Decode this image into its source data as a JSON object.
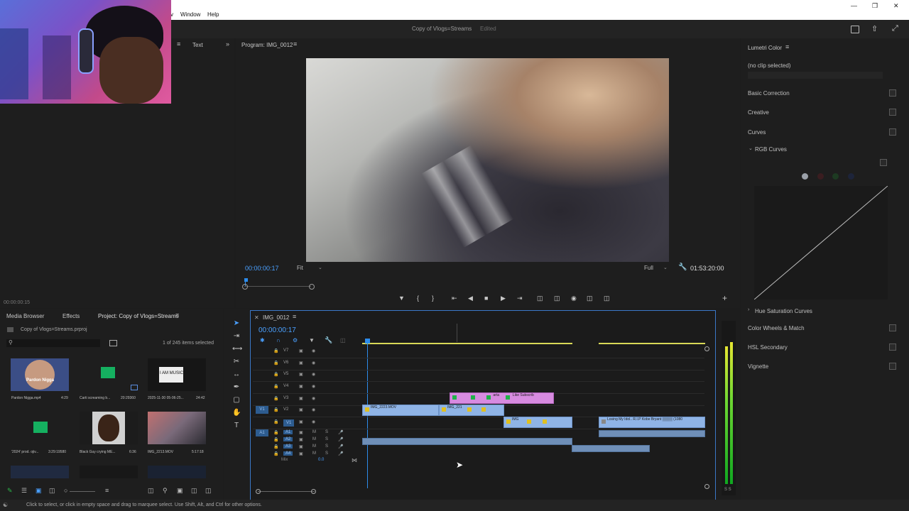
{
  "menu": {
    "window": "Window",
    "help": "Help",
    "v": "v"
  },
  "title": {
    "project": "Copy of Vlogs=Streams",
    "status": "Edited"
  },
  "left_top": {
    "tab_text": "Text",
    "timecode": "00:00:00:15"
  },
  "program": {
    "title": "Program: IMG_0012",
    "timecode": "00:00:00:17",
    "zoom": "Fit",
    "resolution": "Full",
    "duration": "01:53:20:00"
  },
  "lumetri": {
    "title": "Lumetri Color",
    "no_clip": "(no clip selected)",
    "items": [
      "Basic Correction",
      "Creative",
      "Curves",
      "RGB Curves",
      "Hue Saturation Curves",
      "Color Wheels & Match",
      "HSL Secondary",
      "Vignette"
    ]
  },
  "project": {
    "tabs": [
      "Media Browser",
      "Effects",
      "Project: Copy of Vlogs=Streams"
    ],
    "file": "Copy of Vlogs=Streams.prproj",
    "count": "1 of 245 items selected",
    "items": [
      {
        "name": "Pardon Nigga.mp4",
        "dur": "4:29",
        "thumb_text": "Pardon Nigga"
      },
      {
        "name": "Carti screaming b...",
        "dur": "20:29360"
      },
      {
        "name": "2025-11-30 05-06-25...",
        "dur": "24:42",
        "thumb_text": "I AM MUSIC"
      },
      {
        "name": "'2024' prod. ojiv...",
        "dur": "3:29:19580"
      },
      {
        "name": "Black Guy crying ME...",
        "dur": "6:36"
      },
      {
        "name": "IMG_2213.MOV",
        "dur": "5:17:18"
      }
    ]
  },
  "timeline": {
    "title": "IMG_0012",
    "timecode": "00:00:00:17",
    "video_tracks": [
      "V7",
      "V6",
      "V5",
      "V4",
      "V3",
      "V2",
      "V1"
    ],
    "audio_tracks": [
      "A1",
      "A2",
      "A3",
      "A4"
    ],
    "mix_label": "Mix",
    "mix_value": "0.0",
    "src_v": "V1",
    "src_a": "A1",
    "clips": {
      "v2_a": "IMG_2223.MOV",
      "v2_b": "IMG_221",
      "v3_a": "arta",
      "v3_b": "Like Subscrib",
      "v1_a": "IMG",
      "v1_b": "Losing My Idol.. R.I.P Kobe Bryant ▒▒▒▒ (1080"
    }
  },
  "meter_label": "S S",
  "status_text": "Click to select, or click in empty space and drag to marquee select. Use Shift, Alt, and Ctrl for other options.",
  "colors": {
    "accent": "#4aa0ff",
    "video_clip": "#8fb4e6",
    "pink_clip": "#d78be0",
    "playhead": "#2d8ceb"
  }
}
